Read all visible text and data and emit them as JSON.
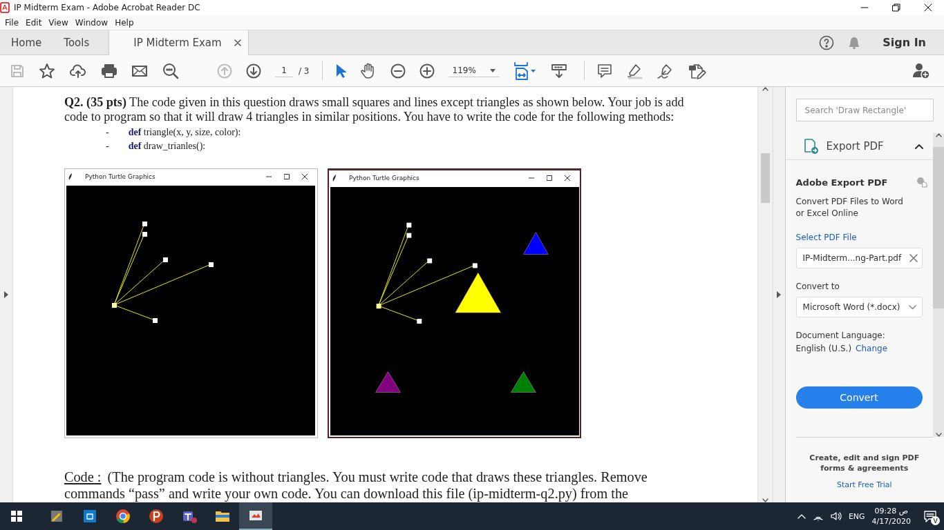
{
  "window": {
    "title": "IP Midterm  Exam - Adobe Acrobat Reader DC"
  },
  "menu": [
    "File",
    "Edit",
    "View",
    "Window",
    "Help"
  ],
  "tabs": [
    {
      "label": "Home",
      "selected": false,
      "kind": "nav"
    },
    {
      "label": "Tools",
      "selected": false,
      "kind": "nav"
    },
    {
      "label": "IP Midterm  Exam",
      "selected": true,
      "kind": "document"
    }
  ],
  "header": {
    "sign_in": "Sign In"
  },
  "toolbar": {
    "page_current": "1",
    "page_total": "/ 3",
    "zoom": "119%"
  },
  "document": {
    "question": "**Q2. (35 pts)** The code given in this question draws small squares and lines except triangles as shown below. Your job is add code to program so that it will draw 4 triangles in similar positions. You have to write the code for the following methods:",
    "methods": [
      {
        "bullet": "-",
        "text": "**def** triangle(x, y, size, color):"
      },
      {
        "bullet": "-",
        "text": "**def** draw_trianles():"
      }
    ],
    "turtle_windows": [
      {
        "title": "Python Turtle Graphics",
        "kind": "without_triangles"
      },
      {
        "title": "Python Turtle Graphics",
        "kind": "with_triangles"
      }
    ],
    "code_label": "Code :",
    "code_text": "(The program code is without triangles. You must write code that draws these triangles. Remove commands “pass” and write your own code. You can download this file (ip-midterm-q2.py) from the"
  },
  "panel": {
    "search_placeholder": "Search 'Draw Rectangle'",
    "section_title": "Export PDF",
    "expanded": true,
    "heading": "Adobe Export PDF",
    "description": "Convert PDF Files to Word or Excel Online",
    "select_label": "Select PDF File",
    "file": "IP-Midterm...ng-Part.pdf",
    "convert_to_label": "Convert to",
    "convert_to": "Microsoft Word (*.docx)",
    "language_label": "Document Language:",
    "language": "English (U.S.)",
    "change": "Change",
    "convert_button": "Convert",
    "promo": "Create, edit and sign PDF forms & agreements",
    "trial": "Start Free Trial"
  },
  "taskbar": {
    "language": "ENG",
    "time": "09:28",
    "ampm": "ص",
    "date": "4/17/2020",
    "badge": "V"
  }
}
